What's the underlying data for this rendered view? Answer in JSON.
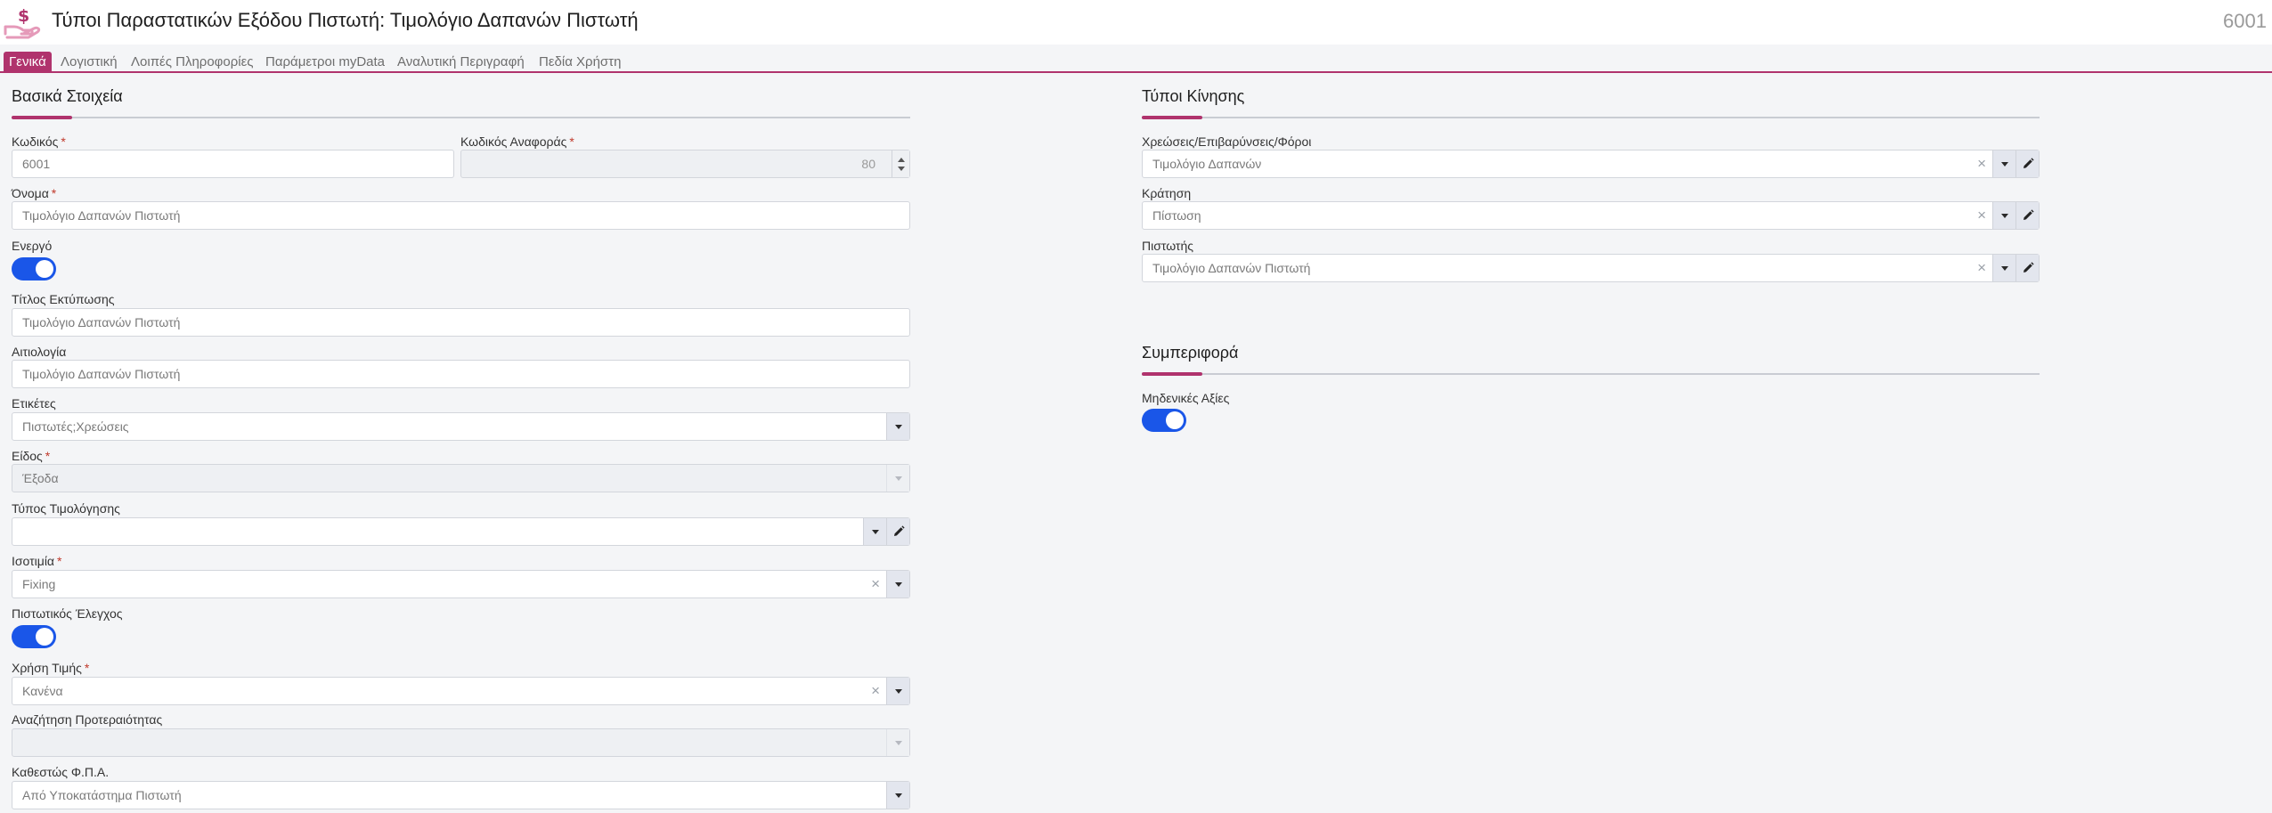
{
  "header": {
    "title": "Τύποι Παραστατικών Εξόδου Πιστωτή: Τιμολόγιο Δαπανών Πιστωτή",
    "record_id": "6001"
  },
  "tabs": [
    {
      "label": "Γενικά",
      "active": true
    },
    {
      "label": "Λογιστική"
    },
    {
      "label": "Λοιπές Πληροφορίες"
    },
    {
      "label": "Παράμετροι myData"
    },
    {
      "label": "Αναλυτική Περιγραφή"
    },
    {
      "label": "Πεδία Χρήστη"
    }
  ],
  "basic": {
    "section_title": "Βασικά Στοιχεία",
    "code": {
      "label": "Κωδικός",
      "value": "6001"
    },
    "ref_code": {
      "label": "Κωδικός Αναφοράς",
      "value": "80"
    },
    "name": {
      "label": "Όνομα",
      "value": "Τιμολόγιο Δαπανών Πιστωτή"
    },
    "active": {
      "label": "Ενεργό",
      "on": true
    },
    "print_title": {
      "label": "Τίτλος Εκτύπωσης",
      "value": "Τιμολόγιο Δαπανών Πιστωτή"
    },
    "reason": {
      "label": "Αιτιολογία",
      "value": "Τιμολόγιο Δαπανών Πιστωτή"
    },
    "tags": {
      "label": "Ετικέτες",
      "value": "Πιστωτές;Χρεώσεις"
    },
    "kind": {
      "label": "Είδος",
      "value": "Έξοδα"
    },
    "invoicing_type": {
      "label": "Τύπος Τιμολόγησης",
      "value": ""
    },
    "parity": {
      "label": "Ισοτιμία",
      "value": "Fixing"
    },
    "credit_check": {
      "label": "Πιστωτικός Έλεγχος",
      "on": true
    },
    "price_use": {
      "label": "Χρήση Τιμής",
      "value": "Κανένα"
    },
    "priority_search": {
      "label": "Αναζήτηση Προτεραιότητας",
      "value": ""
    },
    "vat_status": {
      "label": "Καθεστώς Φ.Π.Α.",
      "value": "Από Υποκατάστημα Πιστωτή"
    },
    "required_mark": "*"
  },
  "movement": {
    "section_title": "Τύποι Κίνησης",
    "charges": {
      "label": "Χρεώσεις/Επιβαρύνσεις/Φόροι",
      "value": "Τιμολόγιο Δαπανών"
    },
    "reservation": {
      "label": "Κράτηση",
      "value": "Πίστωση"
    },
    "creditor": {
      "label": "Πιστωτής",
      "value": "Τιμολόγιο Δαπανών Πιστωτή"
    }
  },
  "behavior": {
    "section_title": "Συμπεριφορά",
    "zero_values": {
      "label": "Μηδενικές Αξίες",
      "on": true
    }
  },
  "icons": {
    "logo": "hand-dollar-icon",
    "clear": "close-icon",
    "dropdown": "chevron-down-icon",
    "edit": "pencil-icon"
  },
  "colors": {
    "accent": "#b0336d",
    "toggle_on": "#1a56e8"
  }
}
